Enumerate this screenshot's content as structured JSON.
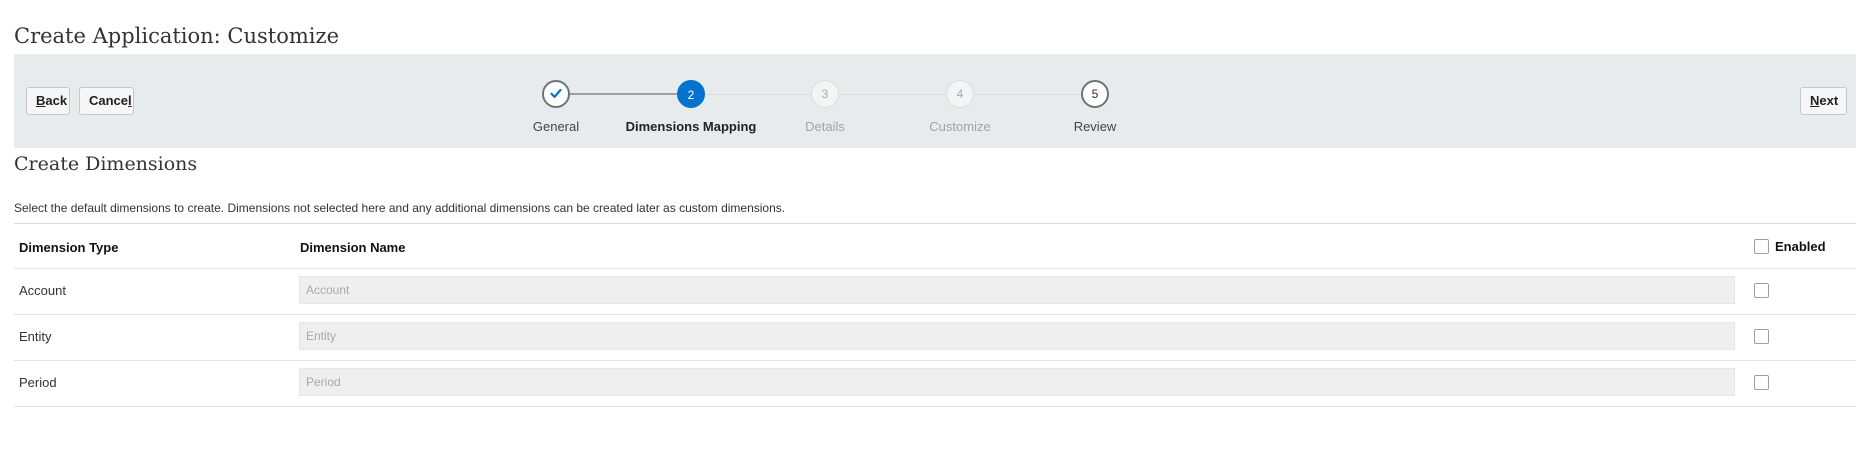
{
  "page_title": "Create Application: Customize",
  "toolbar": {
    "back": {
      "mnemonic": "B",
      "rest": "ack"
    },
    "cancel": {
      "prefix": "Cance",
      "mnemonic": "l"
    },
    "next": {
      "mnemonic": "N",
      "rest": "ext"
    }
  },
  "train": {
    "steps": [
      {
        "number": "",
        "label": "General",
        "state": "visited"
      },
      {
        "number": "2",
        "label": "Dimensions Mapping",
        "state": "current"
      },
      {
        "number": "3",
        "label": "Details",
        "state": "disabled"
      },
      {
        "number": "4",
        "label": "Customize",
        "state": "disabled"
      },
      {
        "number": "5",
        "label": "Review",
        "state": "unvisited"
      }
    ]
  },
  "section": {
    "title": "Create Dimensions",
    "instructions": "Select the default dimensions to create. Dimensions not selected here and any additional dimensions can be created later as custom dimensions."
  },
  "table": {
    "columns": {
      "type": "Dimension Type",
      "name": "Dimension Name",
      "enabled": "Enabled"
    },
    "enabled_all": false,
    "rows": [
      {
        "type": "Account",
        "name_placeholder": "Account",
        "enabled": false
      },
      {
        "type": "Entity",
        "name_placeholder": "Entity",
        "enabled": false
      },
      {
        "type": "Period",
        "name_placeholder": "Period",
        "enabled": false
      }
    ]
  },
  "colors": {
    "accent": "#0572ce",
    "train_bar": "#e8ebec"
  }
}
